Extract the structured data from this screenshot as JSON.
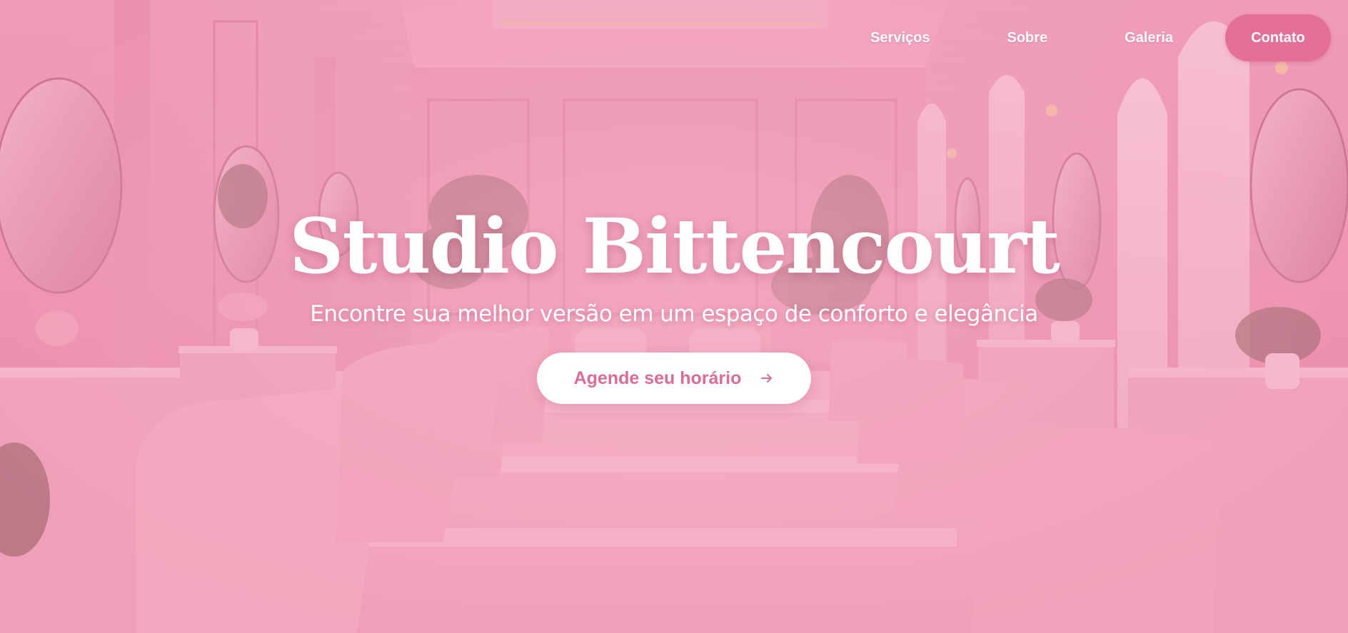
{
  "nav": {
    "items": [
      {
        "label": "Serviços"
      },
      {
        "label": "Sobre"
      },
      {
        "label": "Galeria"
      }
    ],
    "cta_label": "Contato"
  },
  "hero": {
    "title": "Studio Bittencourt",
    "subtitle": "Encontre sua melhor versão em um espaço de conforto e elegância",
    "button_label": "Agende seu horário",
    "button_icon": "arrow-right-icon",
    "background_image": "pink salon interior with mirrors, chairs and plants"
  },
  "colors": {
    "accent": "#e4709a",
    "button_text": "#dc6b95",
    "overlay_pink": "#e98da8",
    "text_light": "#ffffff"
  }
}
